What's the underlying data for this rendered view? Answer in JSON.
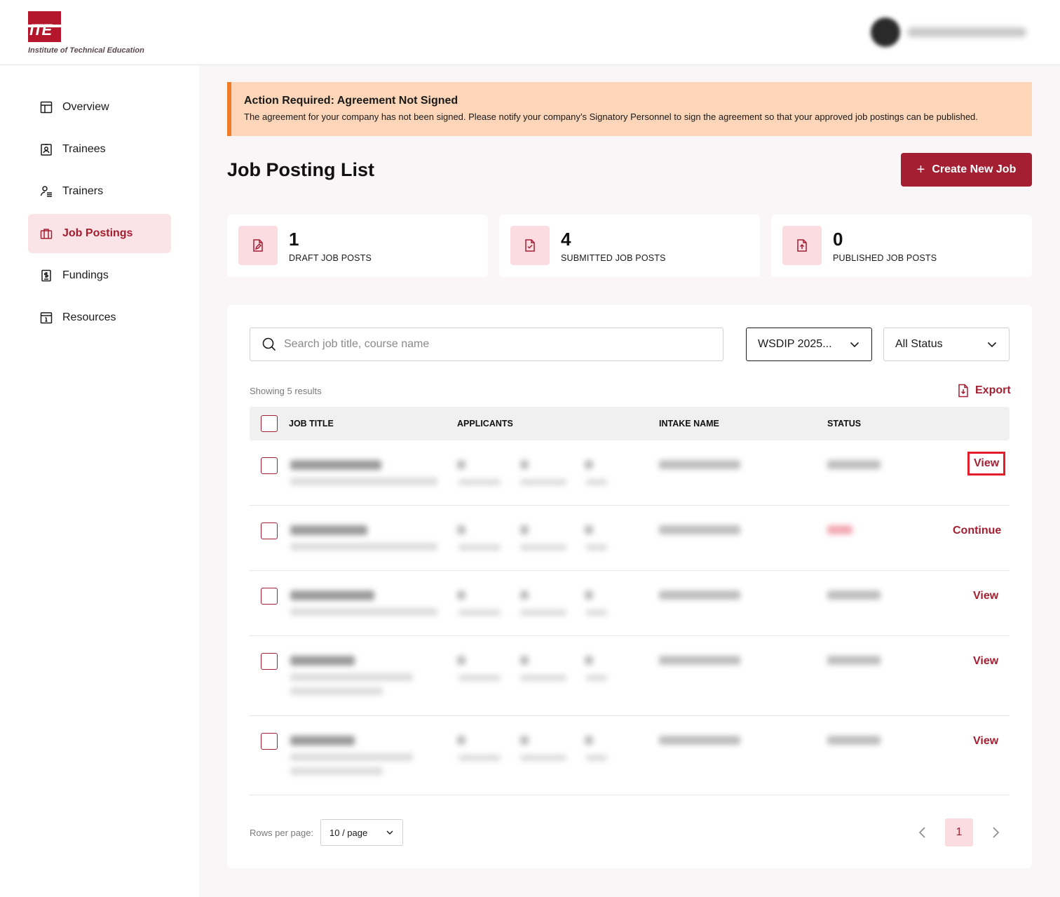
{
  "brand": {
    "logo_mark": "ITE",
    "name": "Institute of Technical Education",
    "color": "#a41f32"
  },
  "sidebar": {
    "items": [
      {
        "label": "Overview",
        "icon": "layout-icon"
      },
      {
        "label": "Trainees",
        "icon": "id-badge-icon"
      },
      {
        "label": "Trainers",
        "icon": "user-list-icon"
      },
      {
        "label": "Job Postings",
        "icon": "briefcase-icon",
        "active": true
      },
      {
        "label": "Fundings",
        "icon": "dollar-document-icon"
      },
      {
        "label": "Resources",
        "icon": "info-calendar-icon"
      }
    ]
  },
  "alert": {
    "title": "Action Required: Agreement Not Signed",
    "body": "The agreement for your company has not been signed. Please notify your company’s Signatory Personnel to sign the agreement so that your approved job postings can be published.",
    "accent": "#f07c27",
    "background": "#fdd5b8"
  },
  "page": {
    "title": "Job Posting List",
    "create_button": "Create New Job"
  },
  "stats": [
    {
      "value": "1",
      "label": "DRAFT JOB POSTS",
      "icon": "edit-document-icon"
    },
    {
      "value": "4",
      "label": "SUBMITTED JOB POSTS",
      "icon": "check-document-icon"
    },
    {
      "value": "0",
      "label": "PUBLISHED JOB POSTS",
      "icon": "upload-document-icon"
    }
  ],
  "filters": {
    "search_placeholder": "Search job title, course name",
    "intake_selected": "WSDIP 2025...",
    "status_selected": "All Status"
  },
  "results": {
    "showing": "Showing 5 results",
    "export_label": "Export"
  },
  "table": {
    "headers": [
      "JOB TITLE",
      "APPLICANTS",
      "INTAKE NAME",
      "STATUS"
    ],
    "rows": [
      {
        "action": "View"
      },
      {
        "action": "Continue"
      },
      {
        "action": "View"
      },
      {
        "action": "View"
      },
      {
        "action": "View"
      }
    ]
  },
  "pagination": {
    "rows_label": "Rows per page:",
    "rows_value": "10 / page",
    "current_page": "1"
  }
}
